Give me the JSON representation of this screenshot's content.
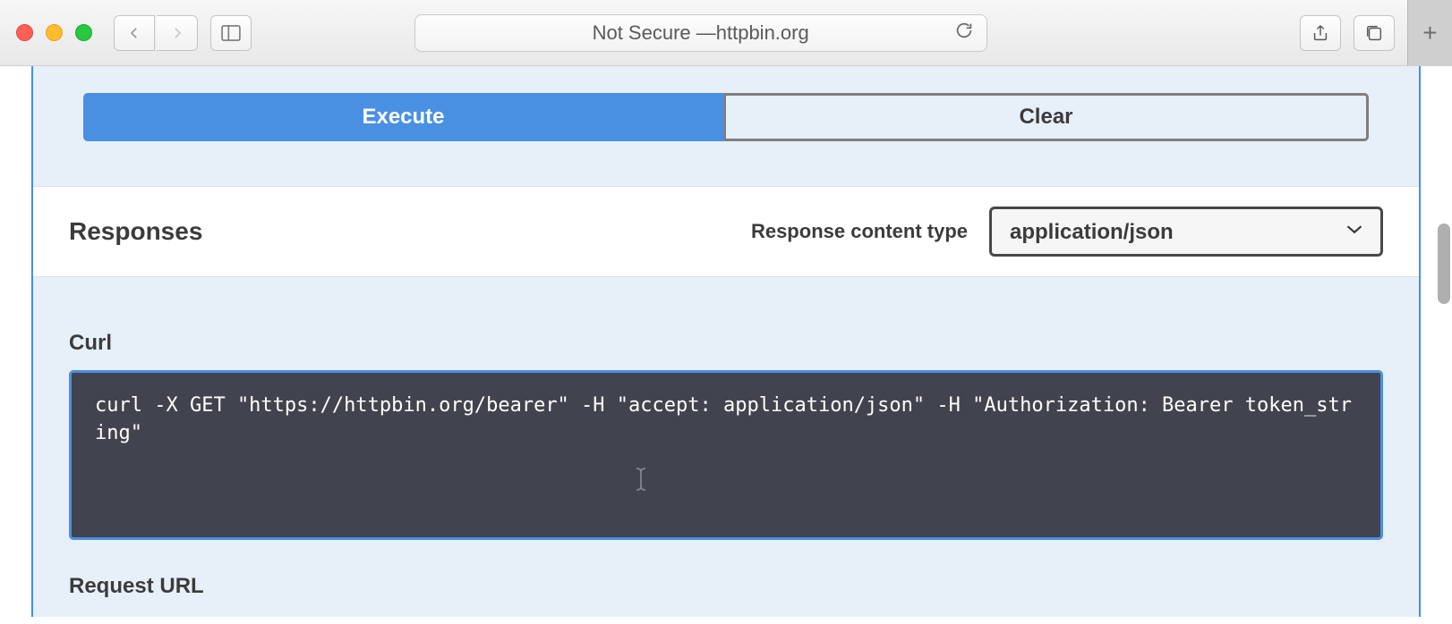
{
  "browser": {
    "address_prefix": "Not Secure — ",
    "address_host": "httpbin.org"
  },
  "swagger": {
    "execute_label": "Execute",
    "clear_label": "Clear",
    "responses_title": "Responses",
    "content_type_label": "Response content type",
    "content_type_value": "application/json",
    "curl_title": "Curl",
    "curl_command": "curl -X GET \"https://httpbin.org/bearer\" -H \"accept: application/json\" -H \"Authorization: Bearer token_string\"",
    "request_url_title": "Request URL"
  }
}
